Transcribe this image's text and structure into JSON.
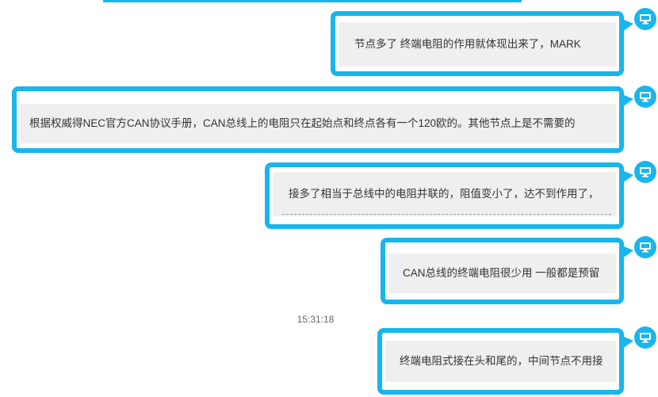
{
  "chat": {
    "messages": [
      {
        "text": "节点多了 终端电阻的作用就体现出来了，MARK"
      },
      {
        "text": "根据权威得NEC官方CAN协议手册，CAN总线上的电阻只在起始点和终点各有一个120欧的。其他节点上是不需要的"
      },
      {
        "text": "接多了相当于总线中的电阻并联的，阻值变小了，达不到作用了，"
      },
      {
        "text": "CAN总线的终端电阻很少用 一般都是预留"
      },
      {
        "text": "终端电阻式接在头和尾的，中间节点不用接"
      }
    ],
    "timestamp": "15:31:18"
  },
  "colors": {
    "accent": "#17b6ec",
    "bubble_bg": "#efefef",
    "text": "#333333"
  },
  "icons": {
    "avatar": "monitor-icon"
  }
}
